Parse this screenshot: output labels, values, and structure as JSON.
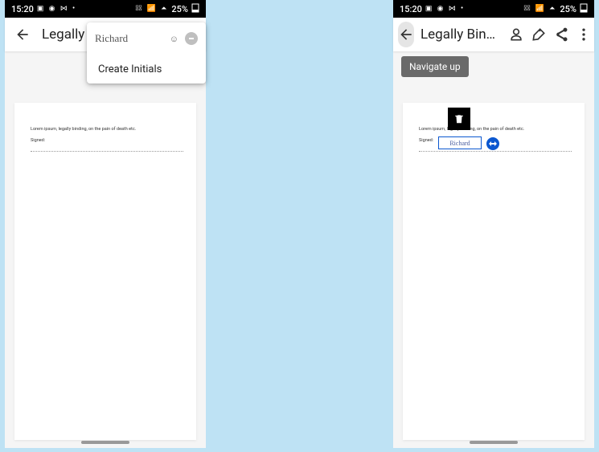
{
  "statusbar": {
    "time": "15:20",
    "left_icons": "▣ ◉ ⋈ •",
    "right_icons": "◀⃠ 📶 ⏶",
    "battery": "25%"
  },
  "appbar": {
    "title": "Legally Bin…"
  },
  "doc": {
    "body": "Lorem ipsum, legally binding, on the pain of death etc.",
    "signed_label": "Signed:"
  },
  "popup": {
    "signature_name": "Richard",
    "smiley": "☺",
    "create_initials": "Create Initials"
  },
  "tooltip": {
    "navigate_up": "Navigate up"
  },
  "placed": {
    "signature_name": "Richard"
  }
}
